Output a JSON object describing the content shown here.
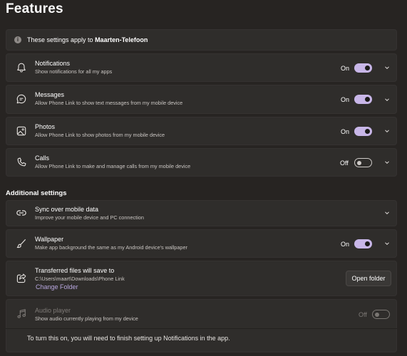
{
  "page": {
    "title": "Features"
  },
  "info": {
    "prefix": "These settings apply to ",
    "device": "Maarten-Telefoon"
  },
  "features": [
    {
      "title": "Notifications",
      "subtitle": "Show notifications for all my apps",
      "state": "On",
      "on": true
    },
    {
      "title": "Messages",
      "subtitle": "Allow Phone Link to show text messages from my mobile device",
      "state": "On",
      "on": true
    },
    {
      "title": "Photos",
      "subtitle": "Allow Phone Link to show photos from my mobile device",
      "state": "On",
      "on": true
    },
    {
      "title": "Calls",
      "subtitle": "Allow Phone Link to make and manage calls from my mobile device",
      "state": "Off",
      "on": false
    }
  ],
  "additional": {
    "title": "Additional settings",
    "sync": {
      "title": "Sync over mobile data",
      "subtitle": "Improve your mobile device and PC connection"
    },
    "wallpaper": {
      "title": "Wallpaper",
      "subtitle": "Make app background the same as my Android device's wallpaper",
      "state": "On",
      "on": true
    },
    "transfer": {
      "title": "Transferred files will save to",
      "path": "C:\\Users\\maart\\Downloads\\Phone Link",
      "change_link": "Change Folder",
      "open_button": "Open folder"
    },
    "audio": {
      "title": "Audio player",
      "subtitle": "Show audio currently playing from my device",
      "state": "Off",
      "on": false,
      "disabled": true
    },
    "footer": "To turn this on, you will need to finish setting up Notifications in the app."
  },
  "colors": {
    "accent": "#c8b6e8",
    "background": "#272422",
    "card": "#2f2d2b",
    "link": "#b9a8e0"
  }
}
